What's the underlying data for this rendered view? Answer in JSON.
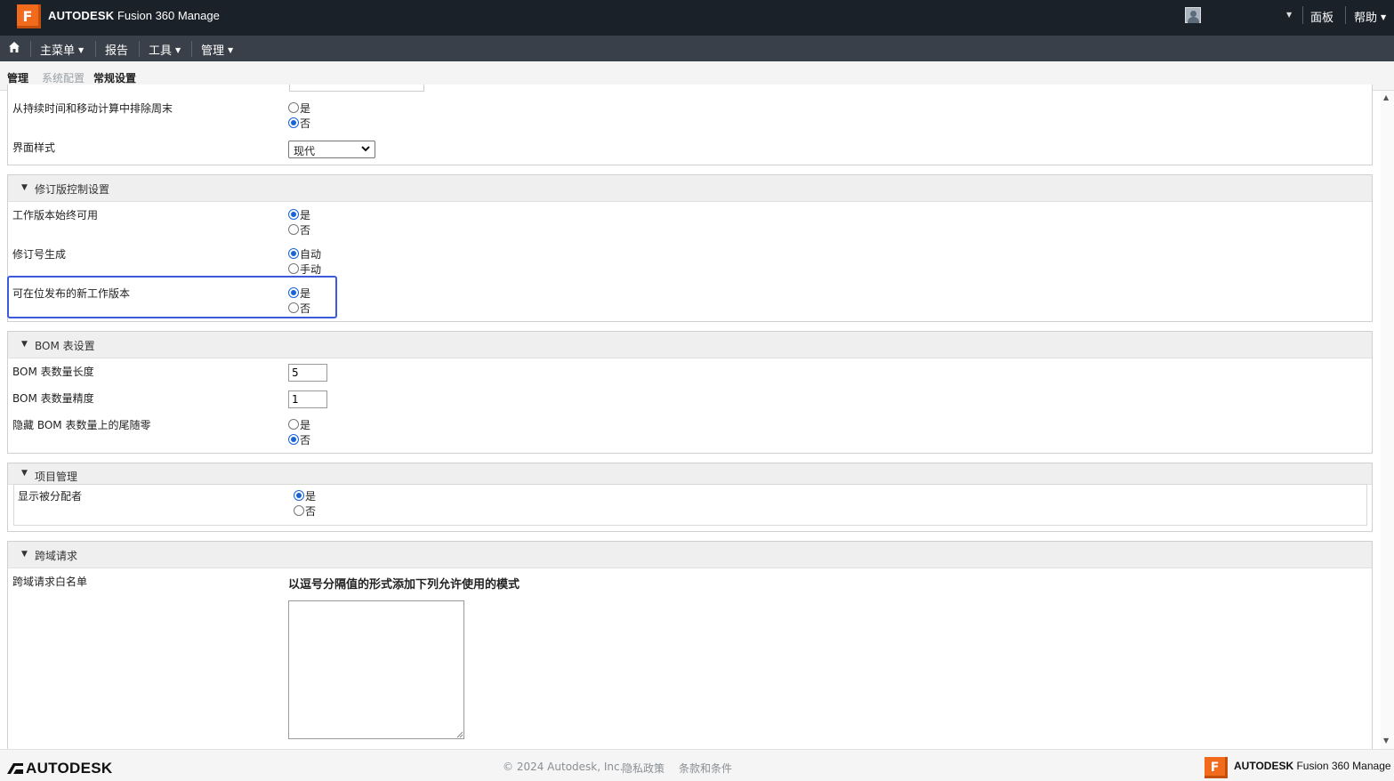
{
  "header": {
    "logo_letter": "F",
    "brand": "AUTODESK",
    "product": "Fusion 360 Manage",
    "links": [
      "面板",
      "帮助"
    ]
  },
  "menubar": {
    "items": [
      "主菜单",
      "报告",
      "工具",
      "管理"
    ]
  },
  "breadcrumb": [
    "管理",
    "系统配置",
    "常规设置"
  ],
  "general": {
    "rows": [
      {
        "label": "从持续时间和移动计算中排除周末",
        "options": [
          "是",
          "否"
        ],
        "selected": 1
      },
      {
        "label": "界面样式",
        "select_value": "现代"
      }
    ]
  },
  "revision": {
    "title": "修订版控制设置",
    "rows": [
      {
        "label": "工作版本始终可用",
        "options": [
          "是",
          "否"
        ],
        "selected": 0
      },
      {
        "label": "修订号生成",
        "options": [
          "自动",
          "手动"
        ],
        "selected": 0
      },
      {
        "label": "可在位发布的新工作版本",
        "options": [
          "是",
          "否"
        ],
        "selected": 0
      }
    ]
  },
  "bom": {
    "title": "BOM 表设置",
    "rows": [
      {
        "label": "BOM 表数量长度",
        "value": "5"
      },
      {
        "label": "BOM 表数量精度",
        "value": "1"
      },
      {
        "label": "隐藏 BOM 表数量上的尾随零",
        "options": [
          "是",
          "否"
        ],
        "selected": 1
      }
    ]
  },
  "project": {
    "title": "项目管理",
    "rows": [
      {
        "label": "显示被分配者",
        "options": [
          "是",
          "否"
        ],
        "selected": 0
      }
    ]
  },
  "cors": {
    "title": "跨域请求",
    "label": "跨域请求白名单",
    "instruction": "以逗号分隔值的形式添加下列允许使用的模式",
    "value": ""
  },
  "footer": {
    "brand": "AUTODESK",
    "copyright": "© 2024 Autodesk, Inc.",
    "privacy": "隐私政策",
    "terms": "条款和条件",
    "logo_letter": "F",
    "app_brand": "AUTODESK",
    "app_product": "Fusion 360 Manage"
  },
  "colors": {
    "header_bg": "#1b2129",
    "menubar_bg": "#3a4049",
    "accent_orange": "#f26a1b",
    "highlight_blue": "#3b5bdb",
    "radio_blue": "#1a63d6"
  }
}
